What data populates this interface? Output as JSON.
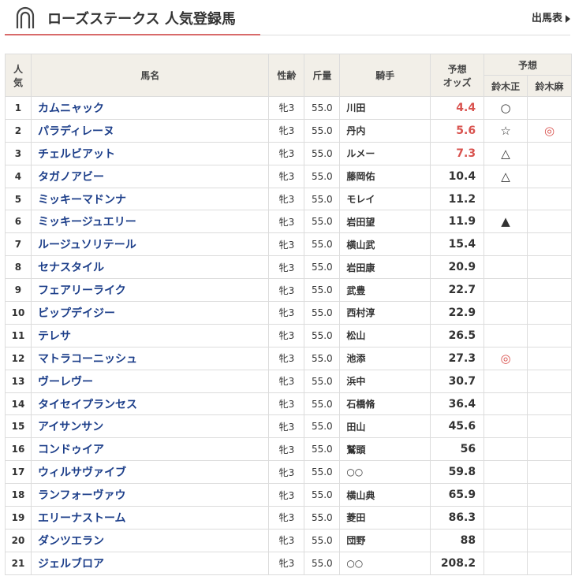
{
  "header": {
    "title": "ローズステークス 人気登録馬",
    "entries_link": "出馬表"
  },
  "columns": {
    "rank": "人気",
    "name": "馬名",
    "sexage": "性齢",
    "weight": "斤量",
    "jockey": "騎手",
    "odds": "予想オッズ",
    "prediction": "予想",
    "pred_a": "鈴木正",
    "pred_b": "鈴木麻"
  },
  "colors": {
    "accent": "#d86a6a",
    "odds_hot": "#d9534f",
    "horse_link": "#1d3f8a"
  },
  "rows": [
    {
      "rank": "1",
      "name": "カムニャック",
      "sexage": "牝3",
      "weight": "55.0",
      "jockey": "川田",
      "odds": "4.4",
      "pa": "○",
      "pb": ""
    },
    {
      "rank": "2",
      "name": "パラディレーヌ",
      "sexage": "牝3",
      "weight": "55.0",
      "jockey": "丹内",
      "odds": "5.6",
      "pa": "☆",
      "pb": "◎"
    },
    {
      "rank": "3",
      "name": "チェルビアット",
      "sexage": "牝3",
      "weight": "55.0",
      "jockey": "ルメー",
      "odds": "7.3",
      "pa": "△",
      "pb": ""
    },
    {
      "rank": "4",
      "name": "タガノアビー",
      "sexage": "牝3",
      "weight": "55.0",
      "jockey": "藤岡佑",
      "odds": "10.4",
      "pa": "△",
      "pb": ""
    },
    {
      "rank": "5",
      "name": "ミッキーマドンナ",
      "sexage": "牝3",
      "weight": "55.0",
      "jockey": "モレイ",
      "odds": "11.2",
      "pa": "",
      "pb": ""
    },
    {
      "rank": "6",
      "name": "ミッキージュエリー",
      "sexage": "牝3",
      "weight": "55.0",
      "jockey": "岩田望",
      "odds": "11.9",
      "pa": "▲",
      "pb": ""
    },
    {
      "rank": "7",
      "name": "ルージュソリテール",
      "sexage": "牝3",
      "weight": "55.0",
      "jockey": "横山武",
      "odds": "15.4",
      "pa": "",
      "pb": ""
    },
    {
      "rank": "8",
      "name": "セナスタイル",
      "sexage": "牝3",
      "weight": "55.0",
      "jockey": "岩田康",
      "odds": "20.9",
      "pa": "",
      "pb": ""
    },
    {
      "rank": "9",
      "name": "フェアリーライク",
      "sexage": "牝3",
      "weight": "55.0",
      "jockey": "武豊",
      "odds": "22.7",
      "pa": "",
      "pb": ""
    },
    {
      "rank": "10",
      "name": "ビップデイジー",
      "sexage": "牝3",
      "weight": "55.0",
      "jockey": "西村淳",
      "odds": "22.9",
      "pa": "",
      "pb": ""
    },
    {
      "rank": "11",
      "name": "テレサ",
      "sexage": "牝3",
      "weight": "55.0",
      "jockey": "松山",
      "odds": "26.5",
      "pa": "",
      "pb": ""
    },
    {
      "rank": "12",
      "name": "マトラコーニッシュ",
      "sexage": "牝3",
      "weight": "55.0",
      "jockey": "池添",
      "odds": "27.3",
      "pa": "◎",
      "pb": ""
    },
    {
      "rank": "13",
      "name": "ヴーレヴー",
      "sexage": "牝3",
      "weight": "55.0",
      "jockey": "浜中",
      "odds": "30.7",
      "pa": "",
      "pb": ""
    },
    {
      "rank": "14",
      "name": "タイセイプランセス",
      "sexage": "牝3",
      "weight": "55.0",
      "jockey": "石橋脩",
      "odds": "36.4",
      "pa": "",
      "pb": ""
    },
    {
      "rank": "15",
      "name": "アイサンサン",
      "sexage": "牝3",
      "weight": "55.0",
      "jockey": "田山",
      "odds": "45.6",
      "pa": "",
      "pb": ""
    },
    {
      "rank": "16",
      "name": "コンドゥイア",
      "sexage": "牝3",
      "weight": "55.0",
      "jockey": "鷲頭",
      "odds": "56",
      "pa": "",
      "pb": ""
    },
    {
      "rank": "17",
      "name": "ウィルサヴァイブ",
      "sexage": "牝3",
      "weight": "55.0",
      "jockey": "○○",
      "odds": "59.8",
      "pa": "",
      "pb": ""
    },
    {
      "rank": "18",
      "name": "ランフォーヴァウ",
      "sexage": "牝3",
      "weight": "55.0",
      "jockey": "横山典",
      "odds": "65.9",
      "pa": "",
      "pb": ""
    },
    {
      "rank": "19",
      "name": "エリーナストーム",
      "sexage": "牝3",
      "weight": "55.0",
      "jockey": "菱田",
      "odds": "86.3",
      "pa": "",
      "pb": ""
    },
    {
      "rank": "20",
      "name": "ダンツエラン",
      "sexage": "牝3",
      "weight": "55.0",
      "jockey": "団野",
      "odds": "88",
      "pa": "",
      "pb": ""
    },
    {
      "rank": "21",
      "name": "ジェルブロア",
      "sexage": "牝3",
      "weight": "55.0",
      "jockey": "○○",
      "odds": "208.2",
      "pa": "",
      "pb": ""
    }
  ]
}
